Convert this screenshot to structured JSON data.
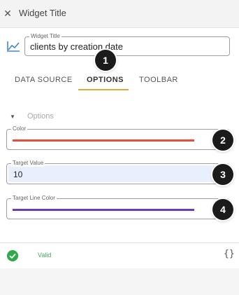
{
  "header": {
    "close_icon": "close-icon",
    "title": "Widget Title"
  },
  "widget_title": {
    "icon": "line-chart-icon",
    "label": "Widget Title",
    "value": "clients by creation date"
  },
  "tabs": [
    {
      "label": "DATA SOURCE",
      "active": false
    },
    {
      "label": "OPTIONS",
      "active": true
    },
    {
      "label": "TOOLBAR",
      "active": false
    }
  ],
  "options_section": {
    "label": "Options",
    "icon": "caret-down-icon"
  },
  "color_field": {
    "label": "Color",
    "color": "#e74c3c",
    "clear_glyph": "✕"
  },
  "target_value_field": {
    "label": "Target Value",
    "value": "10"
  },
  "target_line_color_field": {
    "label": "Target Line Color",
    "color": "#6a3db8",
    "clear_glyph": "✕"
  },
  "badges": [
    "1",
    "2",
    "3",
    "4"
  ],
  "footer": {
    "status_text": "Valid",
    "status_icon": "check-circle-icon",
    "json_toggle": "{}"
  },
  "colors": {
    "accent": "#e8a33d",
    "valid": "#2eaa4a"
  }
}
